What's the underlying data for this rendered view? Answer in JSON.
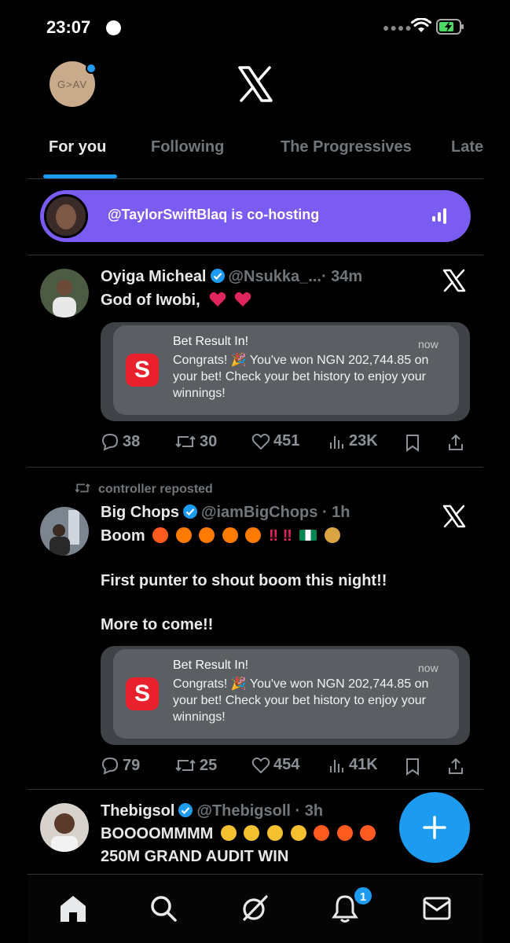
{
  "status_bar": {
    "time": "23:07"
  },
  "header": {
    "avatar_text": "G>AV",
    "logo": "x-logo-icon"
  },
  "tabs": [
    {
      "label": "For you",
      "active": true
    },
    {
      "label": "Following",
      "active": false
    },
    {
      "label": "The Progressives",
      "active": false
    },
    {
      "label": "Late",
      "active": false
    }
  ],
  "space": {
    "text": "@TaylorSwiftBlaq is co-hosting",
    "color": "#7b5cf2"
  },
  "posts": [
    {
      "name": "Oyiga Micheal",
      "handle": "@Nsukka_...",
      "time": "· 34m",
      "text": "God of Iwobi,",
      "emojis": [
        "red-heart",
        "red-heart"
      ],
      "notification": {
        "title": "Bet Result In!",
        "time": "now",
        "body": "Congrats! 🎉 You've won NGN 202,744.85 on your bet! Check your bet history to enjoy your winnings!",
        "app_logo": "S"
      },
      "stats": {
        "replies": "38",
        "reposts": "30",
        "likes": "451",
        "views": "23K"
      }
    },
    {
      "reposted_by": "controller",
      "reposted_label": "reposted",
      "name": "Big Chops",
      "handle": "@iamBigChops",
      "time": "· 1h",
      "text_line1": "Boom",
      "text_line2": "First punter to shout boom this night!!",
      "text_line3": "More to come!!",
      "emojis": [
        "collision",
        "fire",
        "fire",
        "fire",
        "fire",
        "double-exclamation",
        "double-exclamation",
        "nigeria-flag",
        "money-bag"
      ],
      "notification": {
        "title": "Bet Result In!",
        "time": "now",
        "body": "Congrats! 🎉 You've won NGN 202,744.85 on your bet! Check your bet history to enjoy your winnings!",
        "app_logo": "S"
      },
      "stats": {
        "replies": "79",
        "reposts": "25",
        "likes": "454",
        "views": "41K"
      }
    },
    {
      "name": "Thebigsol",
      "handle": "@Thebigsoll",
      "time": "· 3h",
      "text_line1": "BOOOOMMMM",
      "text_line2": "250M GRAND AUDIT WIN",
      "emojis": [
        "sob",
        "sob",
        "sob",
        "sob",
        "collision",
        "collision",
        "collision"
      ]
    }
  ],
  "bottom_nav": {
    "items": [
      "home-icon",
      "search-icon",
      "grok-icon",
      "bell-icon",
      "mail-icon"
    ],
    "notification_badge": "1"
  },
  "colors": {
    "accent": "#1d9bf0",
    "space": "#7b5cf2",
    "heart": "#e0245e"
  }
}
